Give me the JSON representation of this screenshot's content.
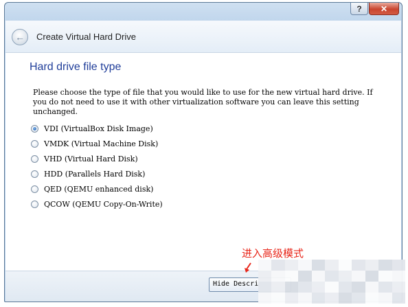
{
  "window": {
    "help_button": "?",
    "close_button": "✕"
  },
  "header": {
    "back_icon": "back-arrow-icon",
    "title": "Create Virtual Hard Drive"
  },
  "page": {
    "heading": "Hard drive file type",
    "description": "Please choose the type of file that you would like to use for the new virtual hard drive. If you do not need to use it with other virtualization software you can leave this setting unchanged."
  },
  "options": [
    {
      "label": "VDI (VirtualBox Disk Image)",
      "checked": true
    },
    {
      "label": "VMDK (Virtual Machine Disk)",
      "checked": false
    },
    {
      "label": "VHD (Virtual Hard Disk)",
      "checked": false
    },
    {
      "label": "HDD (Parallels Hard Disk)",
      "checked": false
    },
    {
      "label": "QED (QEMU enhanced disk)",
      "checked": false
    },
    {
      "label": "QCOW (QEMU Copy-On-Write)",
      "checked": false
    }
  ],
  "footer": {
    "hide_description_button": "Hide Descri"
  },
  "annotation": {
    "text": "进入高级模式",
    "color": "#e8261a"
  },
  "colors": {
    "heading": "#1f3d99",
    "title_bar": "#b9d1ea",
    "close": "#c9452f"
  }
}
